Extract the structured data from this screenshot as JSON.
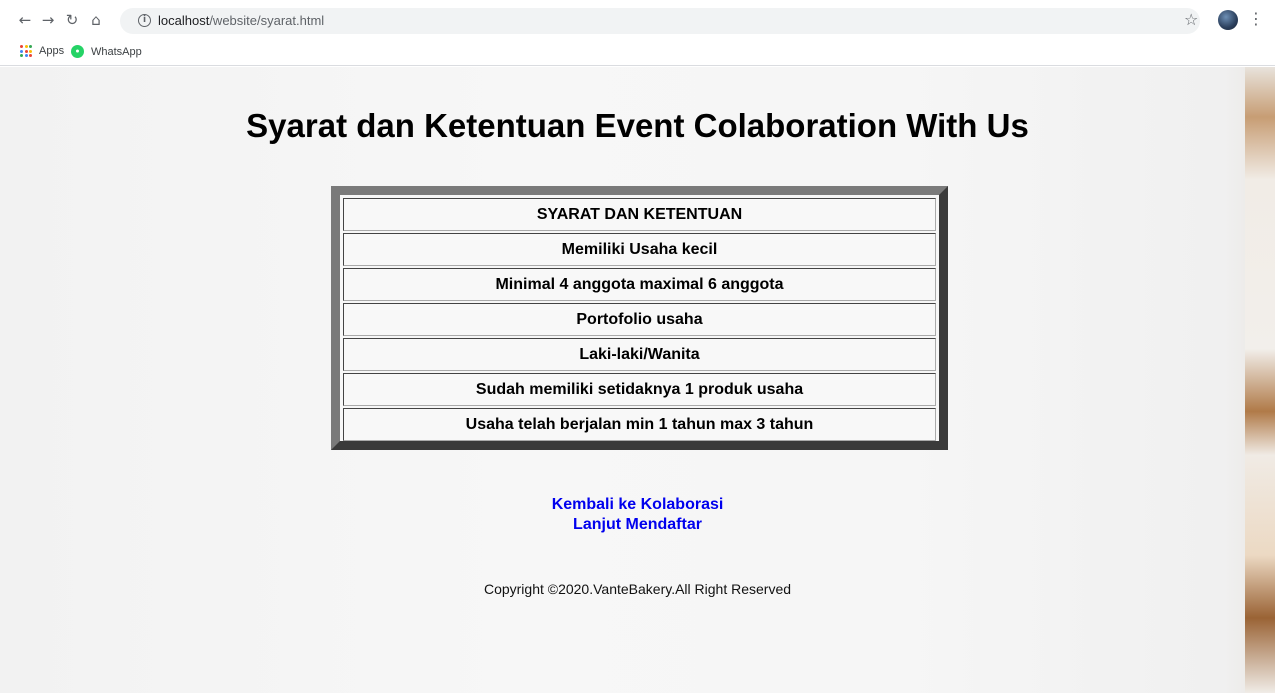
{
  "browser": {
    "url_host": "localhost",
    "url_path": "/website/syarat.html",
    "bookmarks": [
      {
        "label": "Apps"
      },
      {
        "label": "WhatsApp"
      }
    ]
  },
  "page": {
    "title": "Syarat dan Ketentuan Event Colaboration With Us",
    "table_rows": [
      "SYARAT DAN KETENTUAN",
      "Memiliki Usaha kecil",
      "Minimal 4 anggota maximal 6 anggota",
      "Portofolio usaha",
      "Laki-laki/Wanita",
      "Sudah memiliki setidaknya 1 produk usaha",
      "Usaha telah berjalan min 1 tahun max 3 tahun"
    ],
    "links": {
      "back": "Kembali ke Kolaborasi",
      "next": "Lanjut Mendaftar"
    },
    "copyright": "Copyright ©2020.VanteBakery.All Right Reserved"
  }
}
